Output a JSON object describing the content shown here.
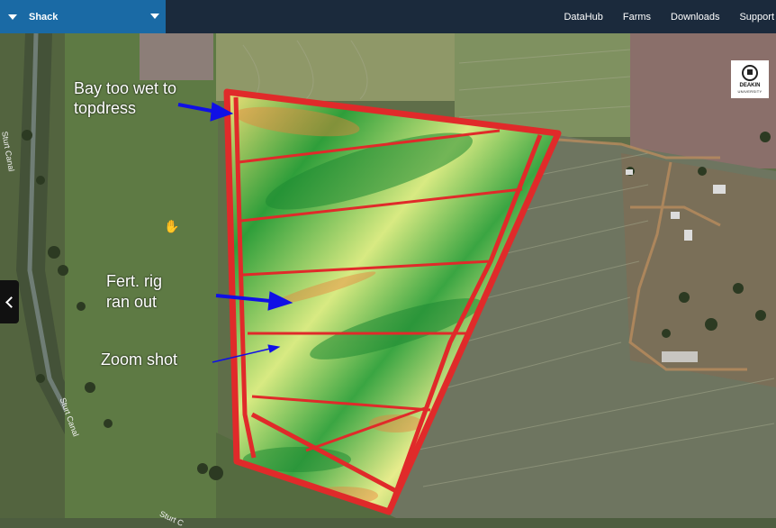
{
  "header": {
    "farm_select": "Shack",
    "nav": [
      "DataHub",
      "Farms",
      "Downloads",
      "Support"
    ]
  },
  "annotations": {
    "bay_wet_line1": "Bay too wet to",
    "bay_wet_line2": "topdress",
    "fert_line1": "Fert. rig",
    "fert_line2": "ran out",
    "zoom": "Zoom shot"
  },
  "logo": {
    "line1": "DEAKIN",
    "line2": "UNIVERSITY"
  },
  "map_labels": {
    "canal_upper": "Sturt Canal",
    "canal_lower": "Sturt Canal",
    "canal_bottom": "Sturt C"
  },
  "colors": {
    "header_bg": "#1b2a3c",
    "farm_select_bg": "#1a6aa5",
    "field_outline": "#e02a2a",
    "arrow": "#1010e6"
  }
}
